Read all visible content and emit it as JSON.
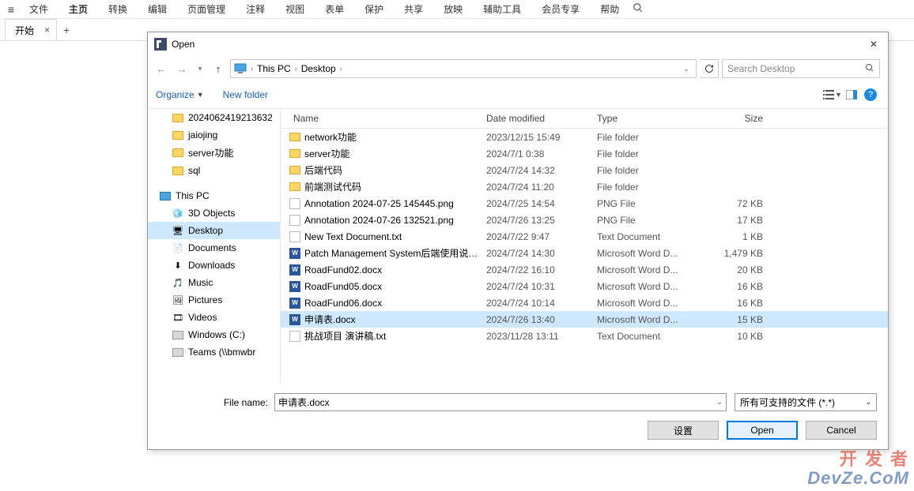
{
  "menubar": {
    "items": [
      "文件",
      "主页",
      "转换",
      "编辑",
      "页面管理",
      "注释",
      "视图",
      "表单",
      "保护",
      "共享",
      "放映",
      "辅助工具",
      "会员专享",
      "帮助"
    ],
    "activeIndex": 1
  },
  "docTab": {
    "title": "开始"
  },
  "dialog": {
    "title": "Open",
    "breadcrumb": {
      "thispc": "This PC",
      "desktop": "Desktop"
    },
    "search": {
      "placeholder": "Search Desktop"
    },
    "toolbar": {
      "organize": "Organize",
      "newfolder": "New folder"
    },
    "sidebar": {
      "recent": [
        {
          "label": "2024062419213632"
        },
        {
          "label": "jaiojing"
        },
        {
          "label": "server功能"
        },
        {
          "label": "sql"
        }
      ],
      "thispc_label": "This PC",
      "locations": [
        {
          "label": "3D Objects",
          "icon": "3d"
        },
        {
          "label": "Desktop",
          "icon": "desktop",
          "selected": true
        },
        {
          "label": "Documents",
          "icon": "doc"
        },
        {
          "label": "Downloads",
          "icon": "dl"
        },
        {
          "label": "Music",
          "icon": "music"
        },
        {
          "label": "Pictures",
          "icon": "pic"
        },
        {
          "label": "Videos",
          "icon": "vid"
        },
        {
          "label": "Windows (C:)",
          "icon": "disk"
        },
        {
          "label": "Teams (\\\\bmwbr",
          "icon": "netdisk"
        }
      ]
    },
    "columns": {
      "name": "Name",
      "date": "Date modified",
      "type": "Type",
      "size": "Size"
    },
    "files": [
      {
        "icon": "folder",
        "name": "network功能",
        "date": "2023/12/15 15:49",
        "type": "File folder",
        "size": ""
      },
      {
        "icon": "folder",
        "name": "server功能",
        "date": "2024/7/1 0:38",
        "type": "File folder",
        "size": ""
      },
      {
        "icon": "folder",
        "name": "后端代码",
        "date": "2024/7/24 14:32",
        "type": "File folder",
        "size": ""
      },
      {
        "icon": "folder",
        "name": "前端测试代码",
        "date": "2024/7/24 11:20",
        "type": "File folder",
        "size": ""
      },
      {
        "icon": "png",
        "name": "Annotation 2024-07-25 145445.png",
        "date": "2024/7/25 14:54",
        "type": "PNG File",
        "size": "72 KB"
      },
      {
        "icon": "png",
        "name": "Annotation 2024-07-26 132521.png",
        "date": "2024/7/26 13:25",
        "type": "PNG File",
        "size": "17 KB"
      },
      {
        "icon": "txt",
        "name": "New Text Document.txt",
        "date": "2024/7/22 9:47",
        "type": "Text Document",
        "size": "1 KB"
      },
      {
        "icon": "word",
        "name": "Patch Management System后端使用说…",
        "date": "2024/7/24 14:30",
        "type": "Microsoft Word D...",
        "size": "1,479 KB"
      },
      {
        "icon": "word",
        "name": "RoadFund02.docx",
        "date": "2024/7/22 16:10",
        "type": "Microsoft Word D...",
        "size": "20 KB"
      },
      {
        "icon": "word",
        "name": "RoadFund05.docx",
        "date": "2024/7/24 10:31",
        "type": "Microsoft Word D...",
        "size": "16 KB"
      },
      {
        "icon": "word",
        "name": "RoadFund06.docx",
        "date": "2024/7/24 10:14",
        "type": "Microsoft Word D...",
        "size": "16 KB"
      },
      {
        "icon": "word",
        "name": "申请表.docx",
        "date": "2024/7/26 13:40",
        "type": "Microsoft Word D...",
        "size": "15 KB",
        "selected": true
      },
      {
        "icon": "txt",
        "name": "挑战项目 演讲稿.txt",
        "date": "2023/11/28 13:11",
        "type": "Text Document",
        "size": "10 KB"
      }
    ],
    "filename_label": "File name:",
    "filename_value": "申请表.docx",
    "filetype_value": "所有可支持的文件 (*.*)",
    "buttons": {
      "settings": "设置",
      "open": "Open",
      "cancel": "Cancel"
    }
  },
  "watermark": {
    "line1": "开 发 者",
    "line2": "DevZe.CoM"
  }
}
